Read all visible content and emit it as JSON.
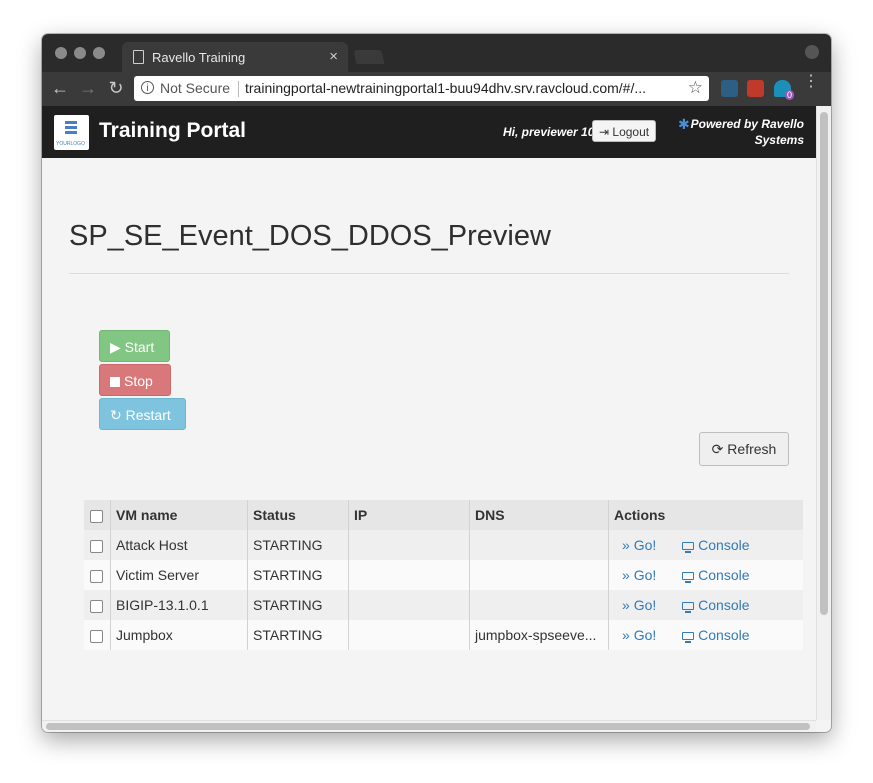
{
  "browser": {
    "tab_title": "Ravello Training",
    "tab_close": "×",
    "security_label": "Not Secure",
    "url": "trainingportal-newtrainingportal1-buu94dhv.srv.ravcloud.com/#/...",
    "icons": {
      "back": "←",
      "forward": "→",
      "reload": "↻",
      "info": "i",
      "star": "☆",
      "menu": "⋮"
    },
    "extension_badge": "0",
    "colors": {
      "titlebar": "#2b2b2b",
      "toolbar": "#3a3a3a"
    }
  },
  "header": {
    "logo_text": "YOURLOGO",
    "title": "Training Portal",
    "greeting": "Hi, previewer 10",
    "logout_label": "Logout",
    "logout_icon": "⇥",
    "powered_icon": "✱",
    "powered_by": "Powered by Ravello Systems",
    "background": "#1f1f1f"
  },
  "page": {
    "title": "SP_SE_Event_DOS_DDOS_Preview"
  },
  "actions": {
    "start_icon": "▶",
    "start_label": "Start",
    "stop_label": "Stop",
    "restart_icon": "↻",
    "restart_label": "Restart",
    "refresh_icon": "⟳",
    "refresh_label": "Refresh",
    "colors": {
      "start": "#82c683",
      "stop": "#d9787a",
      "restart": "#7ec4df"
    }
  },
  "table": {
    "headers": [
      "VM name",
      "Status",
      "IP",
      "DNS",
      "Actions"
    ],
    "go_icon": "»",
    "go_label": "Go!",
    "console_label": "Console",
    "rows": [
      {
        "name": "Attack Host",
        "status": "STARTING",
        "ip": "",
        "dns": ""
      },
      {
        "name": "Victim Server",
        "status": "STARTING",
        "ip": "",
        "dns": ""
      },
      {
        "name": "BIGIP-13.1.0.1",
        "status": "STARTING",
        "ip": "",
        "dns": ""
      },
      {
        "name": "Jumpbox",
        "status": "STARTING",
        "ip": "",
        "dns": "jumpbox-spseeve..."
      }
    ],
    "link_color": "#337ab7"
  }
}
